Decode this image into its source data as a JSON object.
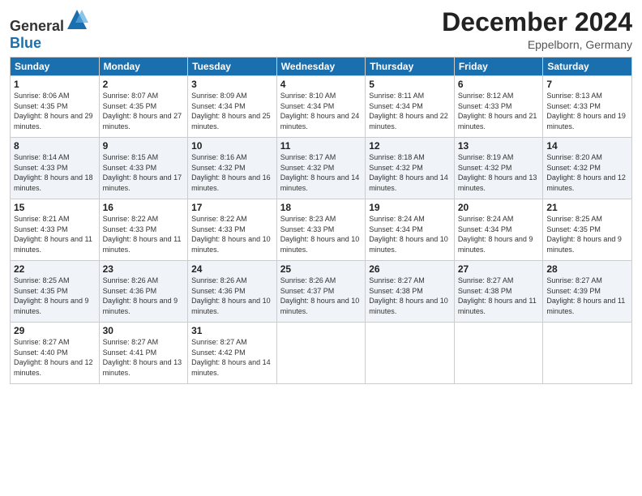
{
  "header": {
    "logo_general": "General",
    "logo_blue": "Blue",
    "month_title": "December 2024",
    "location": "Eppelborn, Germany"
  },
  "weekdays": [
    "Sunday",
    "Monday",
    "Tuesday",
    "Wednesday",
    "Thursday",
    "Friday",
    "Saturday"
  ],
  "weeks": [
    [
      {
        "day": "1",
        "sunrise": "Sunrise: 8:06 AM",
        "sunset": "Sunset: 4:35 PM",
        "daylight": "Daylight: 8 hours and 29 minutes."
      },
      {
        "day": "2",
        "sunrise": "Sunrise: 8:07 AM",
        "sunset": "Sunset: 4:35 PM",
        "daylight": "Daylight: 8 hours and 27 minutes."
      },
      {
        "day": "3",
        "sunrise": "Sunrise: 8:09 AM",
        "sunset": "Sunset: 4:34 PM",
        "daylight": "Daylight: 8 hours and 25 minutes."
      },
      {
        "day": "4",
        "sunrise": "Sunrise: 8:10 AM",
        "sunset": "Sunset: 4:34 PM",
        "daylight": "Daylight: 8 hours and 24 minutes."
      },
      {
        "day": "5",
        "sunrise": "Sunrise: 8:11 AM",
        "sunset": "Sunset: 4:34 PM",
        "daylight": "Daylight: 8 hours and 22 minutes."
      },
      {
        "day": "6",
        "sunrise": "Sunrise: 8:12 AM",
        "sunset": "Sunset: 4:33 PM",
        "daylight": "Daylight: 8 hours and 21 minutes."
      },
      {
        "day": "7",
        "sunrise": "Sunrise: 8:13 AM",
        "sunset": "Sunset: 4:33 PM",
        "daylight": "Daylight: 8 hours and 19 minutes."
      }
    ],
    [
      {
        "day": "8",
        "sunrise": "Sunrise: 8:14 AM",
        "sunset": "Sunset: 4:33 PM",
        "daylight": "Daylight: 8 hours and 18 minutes."
      },
      {
        "day": "9",
        "sunrise": "Sunrise: 8:15 AM",
        "sunset": "Sunset: 4:33 PM",
        "daylight": "Daylight: 8 hours and 17 minutes."
      },
      {
        "day": "10",
        "sunrise": "Sunrise: 8:16 AM",
        "sunset": "Sunset: 4:32 PM",
        "daylight": "Daylight: 8 hours and 16 minutes."
      },
      {
        "day": "11",
        "sunrise": "Sunrise: 8:17 AM",
        "sunset": "Sunset: 4:32 PM",
        "daylight": "Daylight: 8 hours and 14 minutes."
      },
      {
        "day": "12",
        "sunrise": "Sunrise: 8:18 AM",
        "sunset": "Sunset: 4:32 PM",
        "daylight": "Daylight: 8 hours and 14 minutes."
      },
      {
        "day": "13",
        "sunrise": "Sunrise: 8:19 AM",
        "sunset": "Sunset: 4:32 PM",
        "daylight": "Daylight: 8 hours and 13 minutes."
      },
      {
        "day": "14",
        "sunrise": "Sunrise: 8:20 AM",
        "sunset": "Sunset: 4:32 PM",
        "daylight": "Daylight: 8 hours and 12 minutes."
      }
    ],
    [
      {
        "day": "15",
        "sunrise": "Sunrise: 8:21 AM",
        "sunset": "Sunset: 4:33 PM",
        "daylight": "Daylight: 8 hours and 11 minutes."
      },
      {
        "day": "16",
        "sunrise": "Sunrise: 8:22 AM",
        "sunset": "Sunset: 4:33 PM",
        "daylight": "Daylight: 8 hours and 11 minutes."
      },
      {
        "day": "17",
        "sunrise": "Sunrise: 8:22 AM",
        "sunset": "Sunset: 4:33 PM",
        "daylight": "Daylight: 8 hours and 10 minutes."
      },
      {
        "day": "18",
        "sunrise": "Sunrise: 8:23 AM",
        "sunset": "Sunset: 4:33 PM",
        "daylight": "Daylight: 8 hours and 10 minutes."
      },
      {
        "day": "19",
        "sunrise": "Sunrise: 8:24 AM",
        "sunset": "Sunset: 4:34 PM",
        "daylight": "Daylight: 8 hours and 10 minutes."
      },
      {
        "day": "20",
        "sunrise": "Sunrise: 8:24 AM",
        "sunset": "Sunset: 4:34 PM",
        "daylight": "Daylight: 8 hours and 9 minutes."
      },
      {
        "day": "21",
        "sunrise": "Sunrise: 8:25 AM",
        "sunset": "Sunset: 4:35 PM",
        "daylight": "Daylight: 8 hours and 9 minutes."
      }
    ],
    [
      {
        "day": "22",
        "sunrise": "Sunrise: 8:25 AM",
        "sunset": "Sunset: 4:35 PM",
        "daylight": "Daylight: 8 hours and 9 minutes."
      },
      {
        "day": "23",
        "sunrise": "Sunrise: 8:26 AM",
        "sunset": "Sunset: 4:36 PM",
        "daylight": "Daylight: 8 hours and 9 minutes."
      },
      {
        "day": "24",
        "sunrise": "Sunrise: 8:26 AM",
        "sunset": "Sunset: 4:36 PM",
        "daylight": "Daylight: 8 hours and 10 minutes."
      },
      {
        "day": "25",
        "sunrise": "Sunrise: 8:26 AM",
        "sunset": "Sunset: 4:37 PM",
        "daylight": "Daylight: 8 hours and 10 minutes."
      },
      {
        "day": "26",
        "sunrise": "Sunrise: 8:27 AM",
        "sunset": "Sunset: 4:38 PM",
        "daylight": "Daylight: 8 hours and 10 minutes."
      },
      {
        "day": "27",
        "sunrise": "Sunrise: 8:27 AM",
        "sunset": "Sunset: 4:38 PM",
        "daylight": "Daylight: 8 hours and 11 minutes."
      },
      {
        "day": "28",
        "sunrise": "Sunrise: 8:27 AM",
        "sunset": "Sunset: 4:39 PM",
        "daylight": "Daylight: 8 hours and 11 minutes."
      }
    ],
    [
      {
        "day": "29",
        "sunrise": "Sunrise: 8:27 AM",
        "sunset": "Sunset: 4:40 PM",
        "daylight": "Daylight: 8 hours and 12 minutes."
      },
      {
        "day": "30",
        "sunrise": "Sunrise: 8:27 AM",
        "sunset": "Sunset: 4:41 PM",
        "daylight": "Daylight: 8 hours and 13 minutes."
      },
      {
        "day": "31",
        "sunrise": "Sunrise: 8:27 AM",
        "sunset": "Sunset: 4:42 PM",
        "daylight": "Daylight: 8 hours and 14 minutes."
      },
      null,
      null,
      null,
      null
    ]
  ]
}
